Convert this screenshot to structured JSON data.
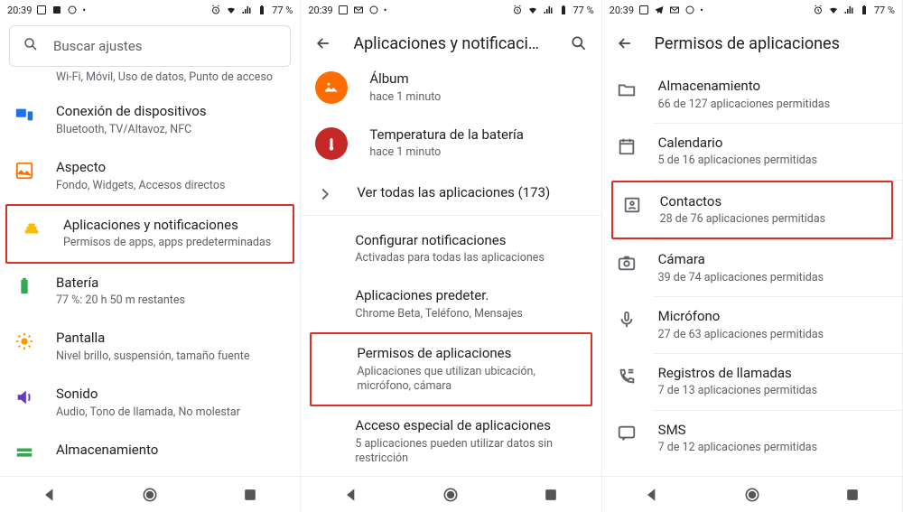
{
  "status": {
    "time": "20:39",
    "battery_text": "77 %"
  },
  "screen1": {
    "search_placeholder": "Buscar ajustes",
    "truncated_prev_sub": "Wi-Fi, Móvil, Uso de datos, Punto de acceso",
    "items": [
      {
        "title": "Conexión de dispositivos",
        "sub": "Bluetooth, TV/Altavoz, NFC"
      },
      {
        "title": "Aspecto",
        "sub": "Fondo, Widgets, Accesos directos"
      },
      {
        "title": "Aplicaciones y notificaciones",
        "sub": "Permisos de apps, apps predeterminadas"
      },
      {
        "title": "Batería",
        "sub": "77 %: 20 h  50 m restantes"
      },
      {
        "title": "Pantalla",
        "sub": "Nivel brillo, suspensión, tamaño fuente"
      },
      {
        "title": "Sonido",
        "sub": "Audio, Tono de llamada, No molestar"
      },
      {
        "title": "Almacenamiento",
        "sub": ""
      }
    ]
  },
  "screen2": {
    "title": "Aplicaciones y notificaci…",
    "recent": [
      {
        "title": "Álbum",
        "sub": "hace 1 minuto"
      },
      {
        "title": "Temperatura de la batería",
        "sub": "hace 1 minuto"
      }
    ],
    "see_all": "Ver todas las aplicaciones (173)",
    "rows": [
      {
        "title": "Configurar notificaciones",
        "sub": "Activadas para todas las aplicaciones"
      },
      {
        "title": "Aplicaciones predeter.",
        "sub": "Chrome Beta, Teléfono, Mensajes"
      },
      {
        "title": "Permisos de aplicaciones",
        "sub": "Aplicaciones que utilizan ubicación, micrófono, cámara"
      },
      {
        "title": "Acceso especial de aplicaciones",
        "sub": "5 aplicaciones pueden utilizar datos sin restricción"
      }
    ]
  },
  "screen3": {
    "title": "Permisos de aplicaciones",
    "rows": [
      {
        "title": "Almacenamiento",
        "sub": "66 de 127 aplicaciones permitidas"
      },
      {
        "title": "Calendario",
        "sub": "5 de 16 aplicaciones permitidas"
      },
      {
        "title": "Contactos",
        "sub": "28 de 76 aplicaciones permitidas"
      },
      {
        "title": "Cámara",
        "sub": "39 de 74 aplicaciones permitidas"
      },
      {
        "title": "Micrófono",
        "sub": "27 de 63 aplicaciones permitidas"
      },
      {
        "title": "Registros de llamadas",
        "sub": "7 de 13 aplicaciones permitidas"
      },
      {
        "title": "SMS",
        "sub": "7 de 12 aplicaciones permitidas"
      }
    ]
  }
}
